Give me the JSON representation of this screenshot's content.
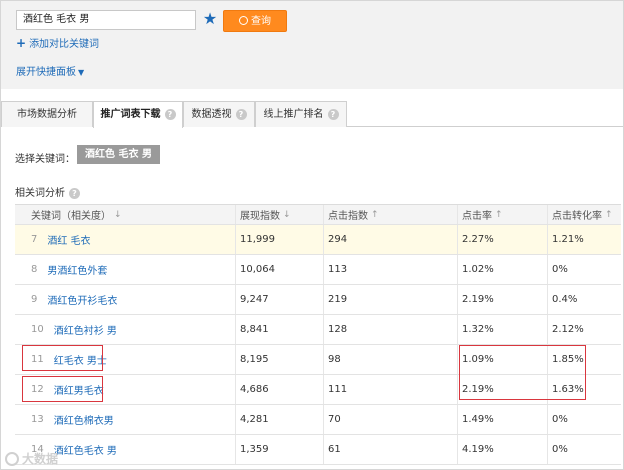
{
  "search": {
    "value": "酒红色 毛衣 男",
    "query_label": "查询"
  },
  "add_compare_label": "添加对比关键词",
  "expand_panel_label": "展开快捷面板",
  "tabs": [
    {
      "label": "市场数据分析",
      "active": false
    },
    {
      "label": "推广词表下载",
      "active": true
    },
    {
      "label": "数据透视",
      "active": false
    },
    {
      "label": "线上推广排名",
      "active": false
    }
  ],
  "selected_keyword": {
    "label": "选择关键词：",
    "value": "酒红色 毛衣 男"
  },
  "related_title": "相关词分析",
  "table": {
    "headers": {
      "keyword": "关键词（相关度）",
      "impressions": "展现指数",
      "clicks": "点击指数",
      "ctr": "点击率",
      "cvr": "点击转化率"
    },
    "rows": [
      {
        "num": "7",
        "keyword": "酒红 毛衣",
        "impressions": "11,999",
        "clicks": "294",
        "ctr": "2.27%",
        "cvr": "1.21%"
      },
      {
        "num": "8",
        "keyword": "男酒红色外套",
        "impressions": "10,064",
        "clicks": "113",
        "ctr": "1.02%",
        "cvr": "0%"
      },
      {
        "num": "9",
        "keyword": "酒红色开衫毛衣",
        "impressions": "9,247",
        "clicks": "219",
        "ctr": "2.19%",
        "cvr": "0.4%"
      },
      {
        "num": "10",
        "keyword": "酒红色衬衫 男",
        "impressions": "8,841",
        "clicks": "128",
        "ctr": "1.32%",
        "cvr": "2.12%"
      },
      {
        "num": "11",
        "keyword": "红毛衣 男士",
        "impressions": "8,195",
        "clicks": "98",
        "ctr": "1.09%",
        "cvr": "1.85%"
      },
      {
        "num": "12",
        "keyword": "酒红男毛衣",
        "impressions": "4,686",
        "clicks": "111",
        "ctr": "2.19%",
        "cvr": "1.63%"
      },
      {
        "num": "13",
        "keyword": "酒红色棉衣男",
        "impressions": "4,281",
        "clicks": "70",
        "ctr": "1.49%",
        "cvr": "0%"
      },
      {
        "num": "14",
        "keyword": "酒红色毛衣 男",
        "impressions": "1,359",
        "clicks": "61",
        "ctr": "4.19%",
        "cvr": "0%"
      }
    ]
  },
  "watermark": "大数据",
  "colors": {
    "accent": "#ff8a1e",
    "link": "#1e6bb8",
    "highlight_box": "#d9363e",
    "tag_bg": "#9a9a9a"
  }
}
